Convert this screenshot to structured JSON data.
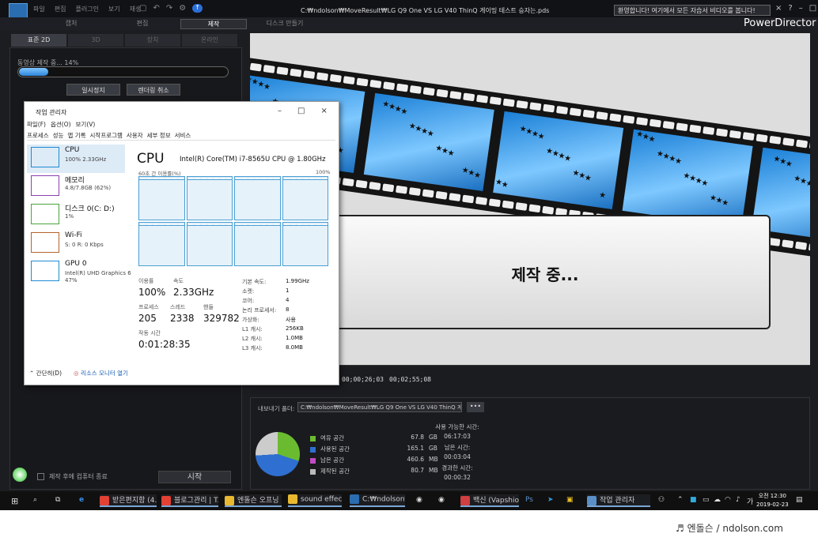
{
  "app": {
    "menu": [
      "파일",
      "편집",
      "플러그인",
      "보기",
      "재생"
    ],
    "doc_title": "C:₩ndolson₩MoveResult₩LG Q9 One VS LG V40 ThinQ 게이밍 테스트 승자는.pds",
    "welcome": "환영합니다! 여기에서 모든 자습서 비디오를 봅니다!",
    "brand": "PowerDirector",
    "modes": [
      "캡처",
      "편집",
      "제작",
      "디스크 만들기"
    ],
    "active_mode": "제작",
    "left_tabs": [
      "표준 2D",
      "3D",
      "장치",
      "온라인"
    ],
    "progress_label": "동영상 제작 중... 14%",
    "progress_value": 0.14,
    "pause_button": "일시정지",
    "cancel_button": "렌더링 취소",
    "shutdown_label": "제작 후에 컴퓨터 종료",
    "start_button": "시작",
    "preview_text": "제작 중...",
    "timecode_elapsed": "00;00;26;03",
    "timecode_total": "00;02;55;08",
    "export_label": "내보내기 폴더:",
    "export_path": "C:₩ndolson₩MoveResult₩LG Q9 One VS LG V40 ThinQ 게이밍",
    "export_dots": "•••",
    "disk": [
      {
        "label": "여유 공간",
        "value": "67.8",
        "unit": "GB",
        "color": "#6bbb31"
      },
      {
        "label": "사용된 공간",
        "value": "165.1",
        "unit": "GB",
        "color": "#2f6fd1"
      },
      {
        "label": "남은 공간",
        "value": "460.6",
        "unit": "MB",
        "color": "#c04cc4"
      },
      {
        "label": "제작된 공간",
        "value": "80.7",
        "unit": "MB",
        "color": "#bbbbbb"
      }
    ],
    "times": [
      {
        "label": "사용 가능한 시간:",
        "value": "06:17:03"
      },
      {
        "label": "남은 시간:",
        "value": "00:03:04"
      },
      {
        "label": "경과한 시간:",
        "value": "00:00:32"
      }
    ]
  },
  "taskmgr": {
    "title": "작업 관리자",
    "menu": [
      "파일(F)",
      "옵션(O)",
      "보기(V)"
    ],
    "tabs": [
      "프로세스",
      "성능",
      "앱 기록",
      "시작프로그램",
      "사용자",
      "세부 정보",
      "서비스"
    ],
    "side": [
      {
        "name": "CPU",
        "sub": "100% 2.33GHz",
        "color": "#1e8ad2"
      },
      {
        "name": "메모리",
        "sub": "4.8/7.8GB (62%)",
        "color": "#8b3fb0"
      },
      {
        "name": "디스크 0(C: D:)",
        "sub": "1%",
        "color": "#4aa53a"
      },
      {
        "name": "Wi-Fi",
        "sub": "S: 0 R: 0 Kbps",
        "color": "#b4642a"
      },
      {
        "name": "GPU 0",
        "sub": "Intel(R) UHD Graphics 6",
        "sub2": "47%",
        "color": "#1e8ad2"
      }
    ],
    "cpu_title": "CPU",
    "cpu_model": "Intel(R) Core(TM) i7-8565U CPU @ 1.80GHz",
    "graph_label": "60초 간 이용률(%)",
    "graph_max": "100%",
    "core_usage": [
      0.94,
      0.94,
      0.94,
      0.94,
      0.94,
      0.94,
      0.94,
      0.94
    ],
    "usage_label": "이용률",
    "usage": "100%",
    "speed_label": "속도",
    "speed": "2.33GHz",
    "proc_label": "프로세스",
    "proc": "205",
    "thread_label": "스레드",
    "thread": "2338",
    "handle_label": "핸들",
    "handle": "329782",
    "uptime_label": "작동 시간",
    "uptime": "0:01:28:35",
    "specs": [
      {
        "k": "기본 속도:",
        "v": "1.99GHz"
      },
      {
        "k": "소켓:",
        "v": "1"
      },
      {
        "k": "코어:",
        "v": "4"
      },
      {
        "k": "논리 프로세서:",
        "v": "8"
      },
      {
        "k": "가상화:",
        "v": "사용"
      },
      {
        "k": "L1 캐시:",
        "v": "256KB"
      },
      {
        "k": "L2 캐시:",
        "v": "1.0MB"
      },
      {
        "k": "L3 캐시:",
        "v": "8.0MB"
      }
    ],
    "fewer_details": "간단히(D)",
    "resmon": "리소스 모니터 열기"
  },
  "taskbar": {
    "items": [
      {
        "label": "받은편지함 (4...",
        "color": "#e34133"
      },
      {
        "label": "블로그관리 | T...",
        "color": "#e34133"
      },
      {
        "label": "엔돌슨 오프닝",
        "color": "#e8b930"
      },
      {
        "label": "sound effect",
        "color": "#e8b930"
      },
      {
        "label": "C:₩ndolson₩...",
        "color": "#2a6db0"
      },
      {
        "label": "백신 (Vapshio...",
        "color": "#d04040"
      },
      {
        "label": "작업 관리자",
        "color": "#5b8fc7"
      }
    ],
    "time": "오전 12:30",
    "date": "2019-02-23"
  },
  "footer": "♬ 엔돌슨 / ndolson.com"
}
